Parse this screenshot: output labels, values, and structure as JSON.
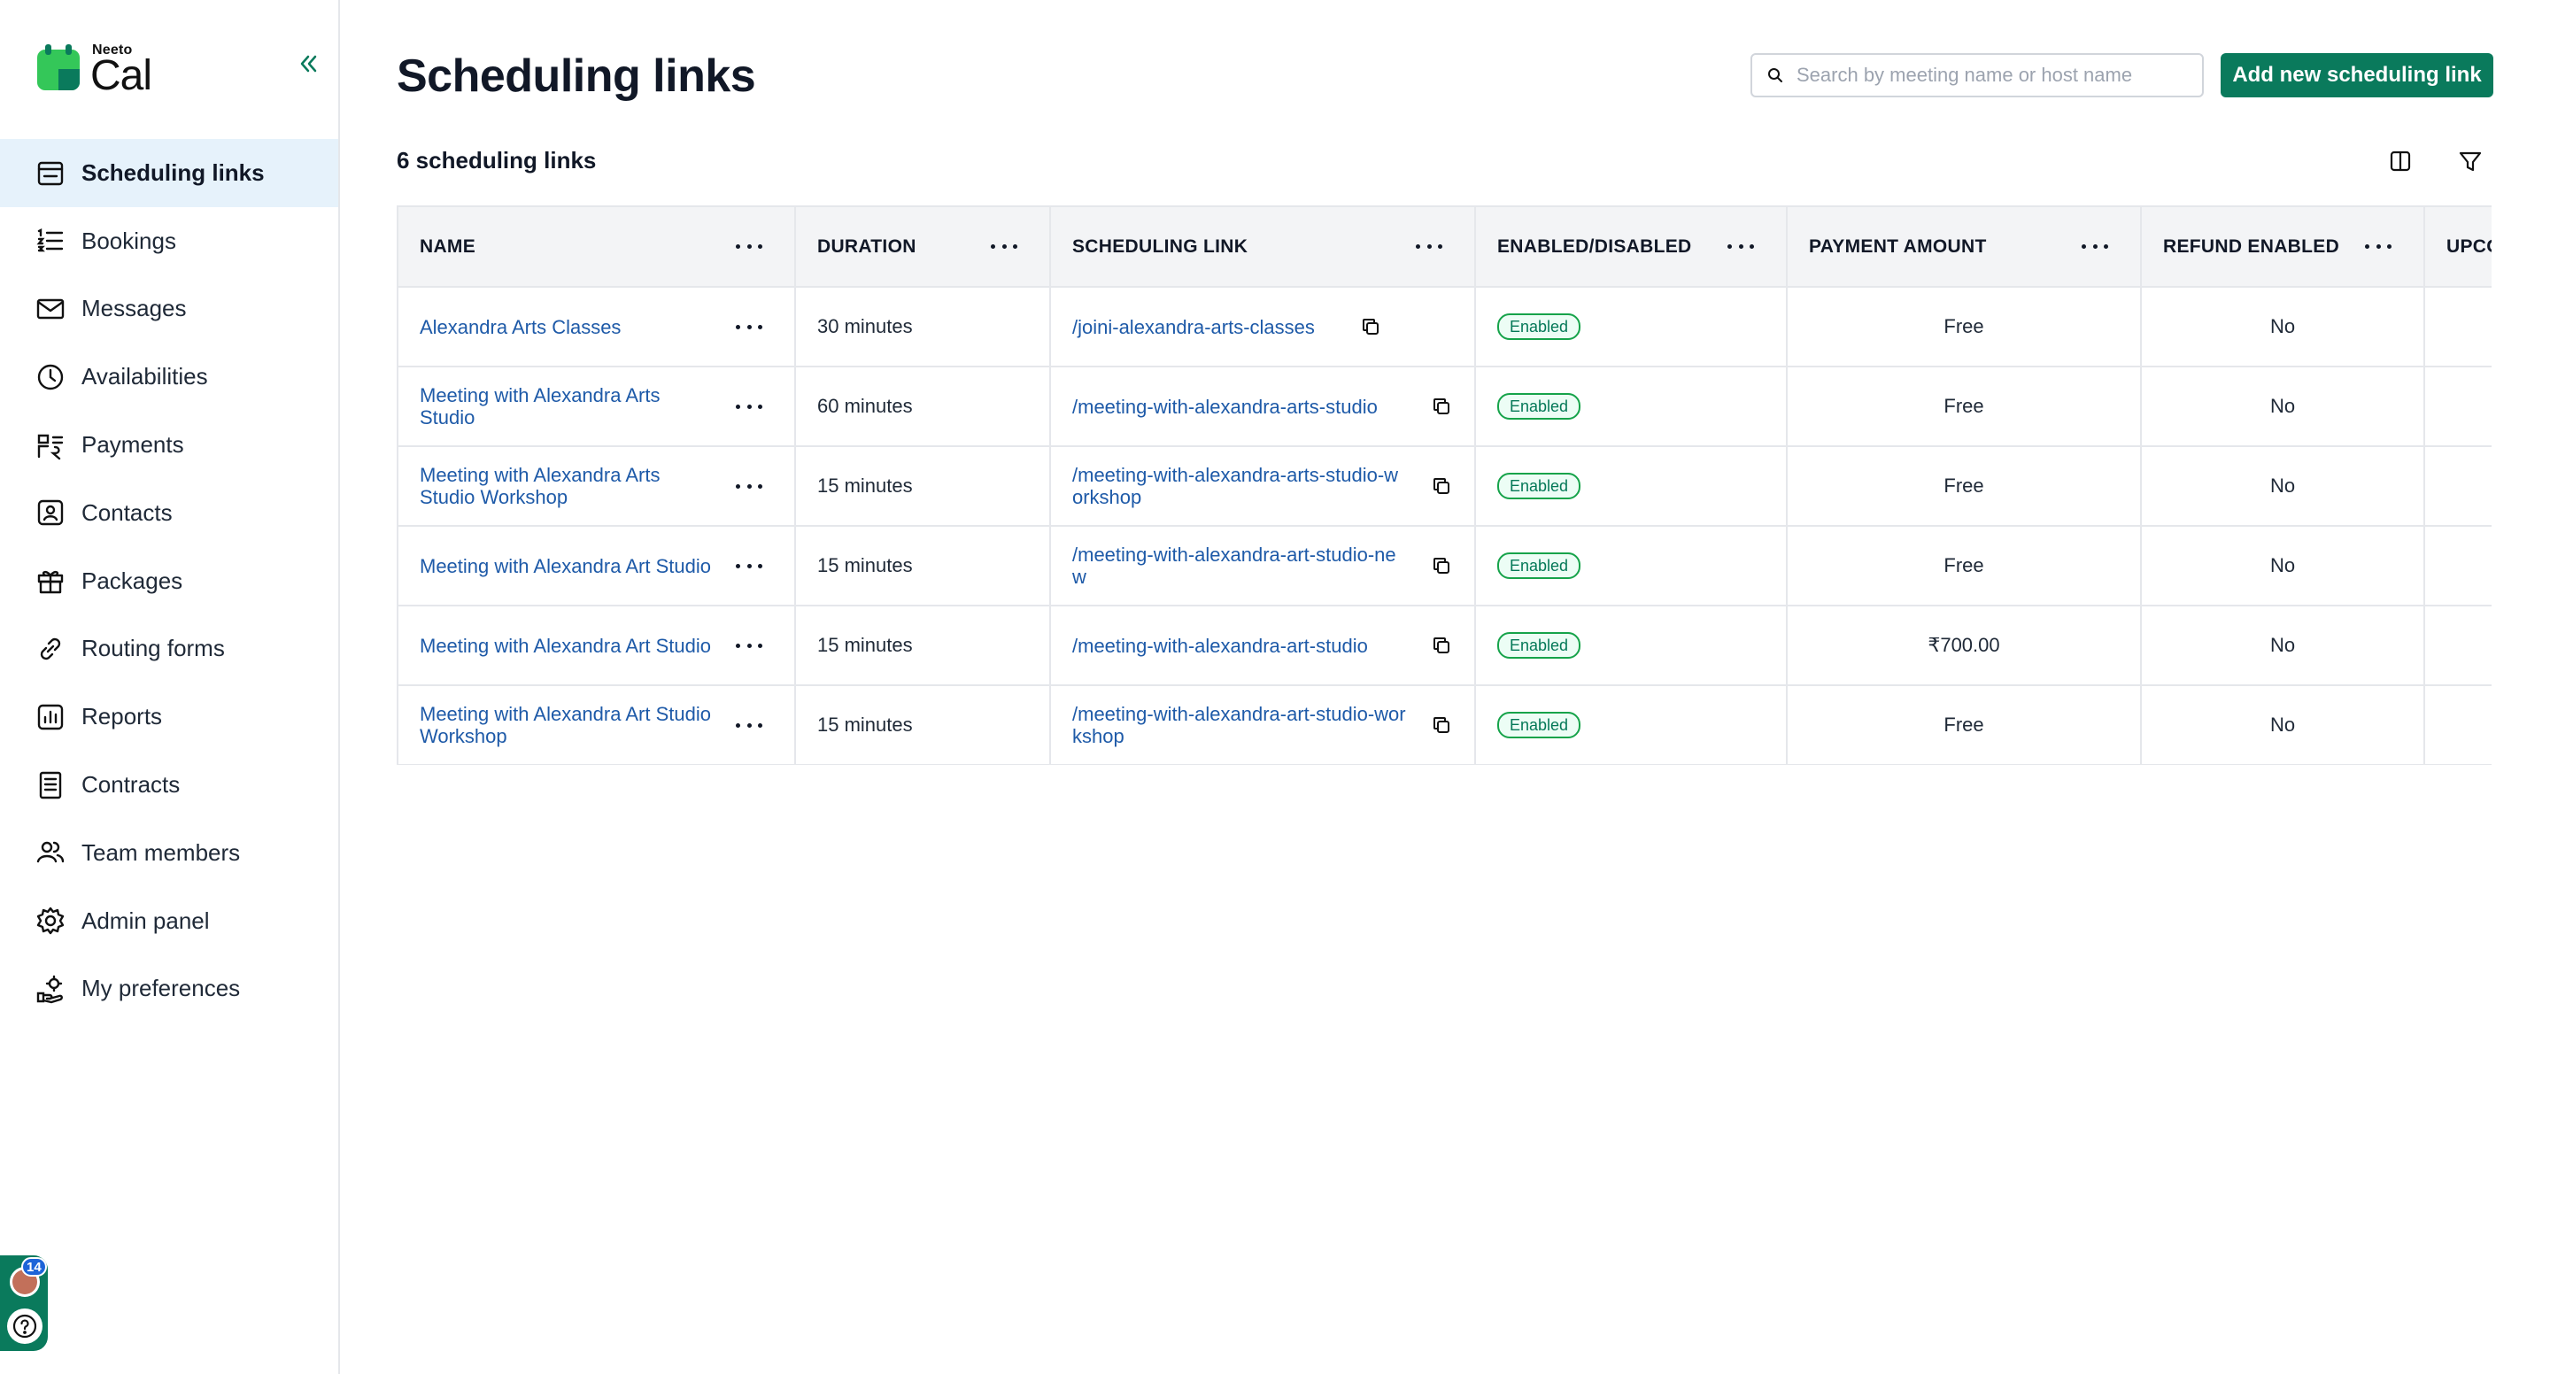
{
  "app": {
    "brand_small": "Neeto",
    "brand_name": "Cal",
    "accent": "#0a7a5c"
  },
  "sidebar": {
    "items": [
      {
        "label": "Scheduling links",
        "icon": "calendar-icon",
        "active": true
      },
      {
        "label": "Bookings",
        "icon": "list-icon"
      },
      {
        "label": "Messages",
        "icon": "mail-icon"
      },
      {
        "label": "Availabilities",
        "icon": "clock-icon"
      },
      {
        "label": "Payments",
        "icon": "payments-icon"
      },
      {
        "label": "Contacts",
        "icon": "contact-card-icon"
      },
      {
        "label": "Packages",
        "icon": "gift-icon"
      },
      {
        "label": "Routing forms",
        "icon": "link-icon"
      },
      {
        "label": "Reports",
        "icon": "chart-icon"
      },
      {
        "label": "Contracts",
        "icon": "document-icon"
      },
      {
        "label": "Team members",
        "icon": "team-icon"
      },
      {
        "label": "Admin panel",
        "icon": "gear-icon"
      },
      {
        "label": "My preferences",
        "icon": "preferences-icon"
      }
    ],
    "notification_count": "14"
  },
  "header": {
    "title": "Scheduling links",
    "search_placeholder": "Search by meeting name or host name",
    "add_button": "Add new scheduling link"
  },
  "summary": {
    "count_text": "6 scheduling links"
  },
  "table": {
    "columns": [
      "NAME",
      "DURATION",
      "SCHEDULING LINK",
      "ENABLED/DISABLED",
      "PAYMENT AMOUNT",
      "REFUND ENABLED",
      "UPCOMING"
    ],
    "rows": [
      {
        "name": "Alexandra Arts Classes",
        "duration": "30 minutes",
        "link": "/joini-alexandra-arts-classes",
        "status": "Enabled",
        "payment": "Free",
        "refund": "No"
      },
      {
        "name": "Meeting with Alexandra Arts Studio",
        "duration": "60 minutes",
        "link": "/meeting-with-alexandra-arts-studio",
        "status": "Enabled",
        "payment": "Free",
        "refund": "No"
      },
      {
        "name": "Meeting with Alexandra Arts Studio Workshop",
        "duration": "15 minutes",
        "link": "/meeting-with-alexandra-arts-studio-workshop",
        "status": "Enabled",
        "payment": "Free",
        "refund": "No"
      },
      {
        "name": "Meeting with Alexandra Art Studio",
        "duration": "15 minutes",
        "link": "/meeting-with-alexandra-art-studio-new",
        "status": "Enabled",
        "payment": "Free",
        "refund": "No"
      },
      {
        "name": "Meeting with Alexandra Art Studio",
        "duration": "15 minutes",
        "link": "/meeting-with-alexandra-art-studio",
        "status": "Enabled",
        "payment": "₹700.00",
        "refund": "No"
      },
      {
        "name": "Meeting with Alexandra Art Studio Workshop",
        "duration": "15 minutes",
        "link": "/meeting-with-alexandra-art-studio-workshop",
        "status": "Enabled",
        "payment": "Free",
        "refund": "No"
      }
    ]
  }
}
